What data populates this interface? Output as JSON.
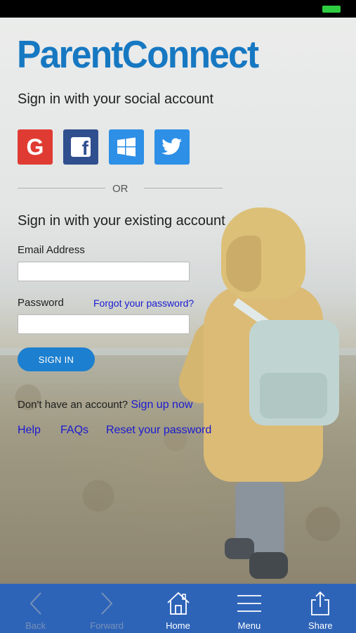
{
  "app": {
    "logo_text": "ParentConnect",
    "brand_color": "#1778c2"
  },
  "social": {
    "title": "Sign in with your social account",
    "providers": [
      {
        "name": "Google",
        "icon": "google-icon",
        "color": "#e03b33"
      },
      {
        "name": "Facebook",
        "icon": "facebook-icon",
        "color": "#2f4f8f"
      },
      {
        "name": "Windows",
        "icon": "windows-icon",
        "color": "#2d8fe6"
      },
      {
        "name": "Twitter",
        "icon": "twitter-icon",
        "color": "#2d8fe6"
      }
    ],
    "or_text": "OR"
  },
  "existing": {
    "title": "Sign in with your existing account",
    "email_label": "Email Address",
    "email_value": "",
    "password_label": "Password",
    "password_value": "",
    "forgot_link": "Forgot your password?",
    "signin_button": "SIGN IN",
    "no_account_text": "Don't have an account?",
    "signup_link": "Sign up now"
  },
  "footer_links": {
    "help": "Help",
    "faqs": "FAQs",
    "reset": "Reset your password"
  },
  "tab_bar": {
    "color": "#2e64b8",
    "tabs": [
      {
        "label": "Back",
        "icon": "chevron-left-icon",
        "enabled": false
      },
      {
        "label": "Forward",
        "icon": "chevron-right-icon",
        "enabled": false
      },
      {
        "label": "Home",
        "icon": "home-icon",
        "enabled": true
      },
      {
        "label": "Menu",
        "icon": "hamburger-menu-icon",
        "enabled": true
      },
      {
        "label": "Share",
        "icon": "share-icon",
        "enabled": true
      }
    ]
  }
}
